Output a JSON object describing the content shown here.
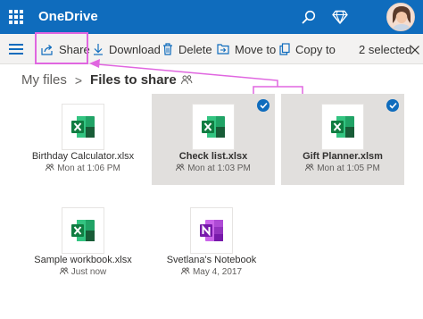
{
  "app": {
    "title": "OneDrive"
  },
  "commands": {
    "share": "Share",
    "download": "Download",
    "delete": "Delete",
    "move_to": "Move to",
    "copy_to": "Copy to",
    "selected": "2 selected"
  },
  "breadcrumb": {
    "parent": "My files",
    "separator": ">",
    "current": "Files to share"
  },
  "files": [
    {
      "name": "Birthday Calculator.xlsx",
      "meta": "Mon at 1:06 PM",
      "type": "excel",
      "selected": false
    },
    {
      "name": "Check list.xlsx",
      "meta": "Mon at 1:03 PM",
      "type": "excel",
      "selected": true
    },
    {
      "name": "Gift Planner.xlsm",
      "meta": "Mon at 1:05 PM",
      "type": "excel",
      "selected": true
    },
    {
      "name": "Sample workbook.xlsx",
      "meta": "Just now",
      "type": "excel",
      "selected": false
    },
    {
      "name": "Svetlana's Notebook",
      "meta": "May 4, 2017",
      "type": "onenote",
      "selected": false
    }
  ],
  "colors": {
    "brand": "#0f6cbd",
    "excel": "#107c41",
    "onenote": "#7719aa",
    "highlight": "#e066e0",
    "selected_tile": "#e1dfdd"
  },
  "icons": {
    "appbar": [
      "app-launcher-icon",
      "search-icon",
      "premium-diamond-icon",
      "user-avatar"
    ],
    "commands": [
      "menu-icon",
      "share-icon",
      "download-icon",
      "delete-icon",
      "move-to-icon",
      "copy-to-icon"
    ],
    "breadcrumb": "shared-people-icon"
  }
}
